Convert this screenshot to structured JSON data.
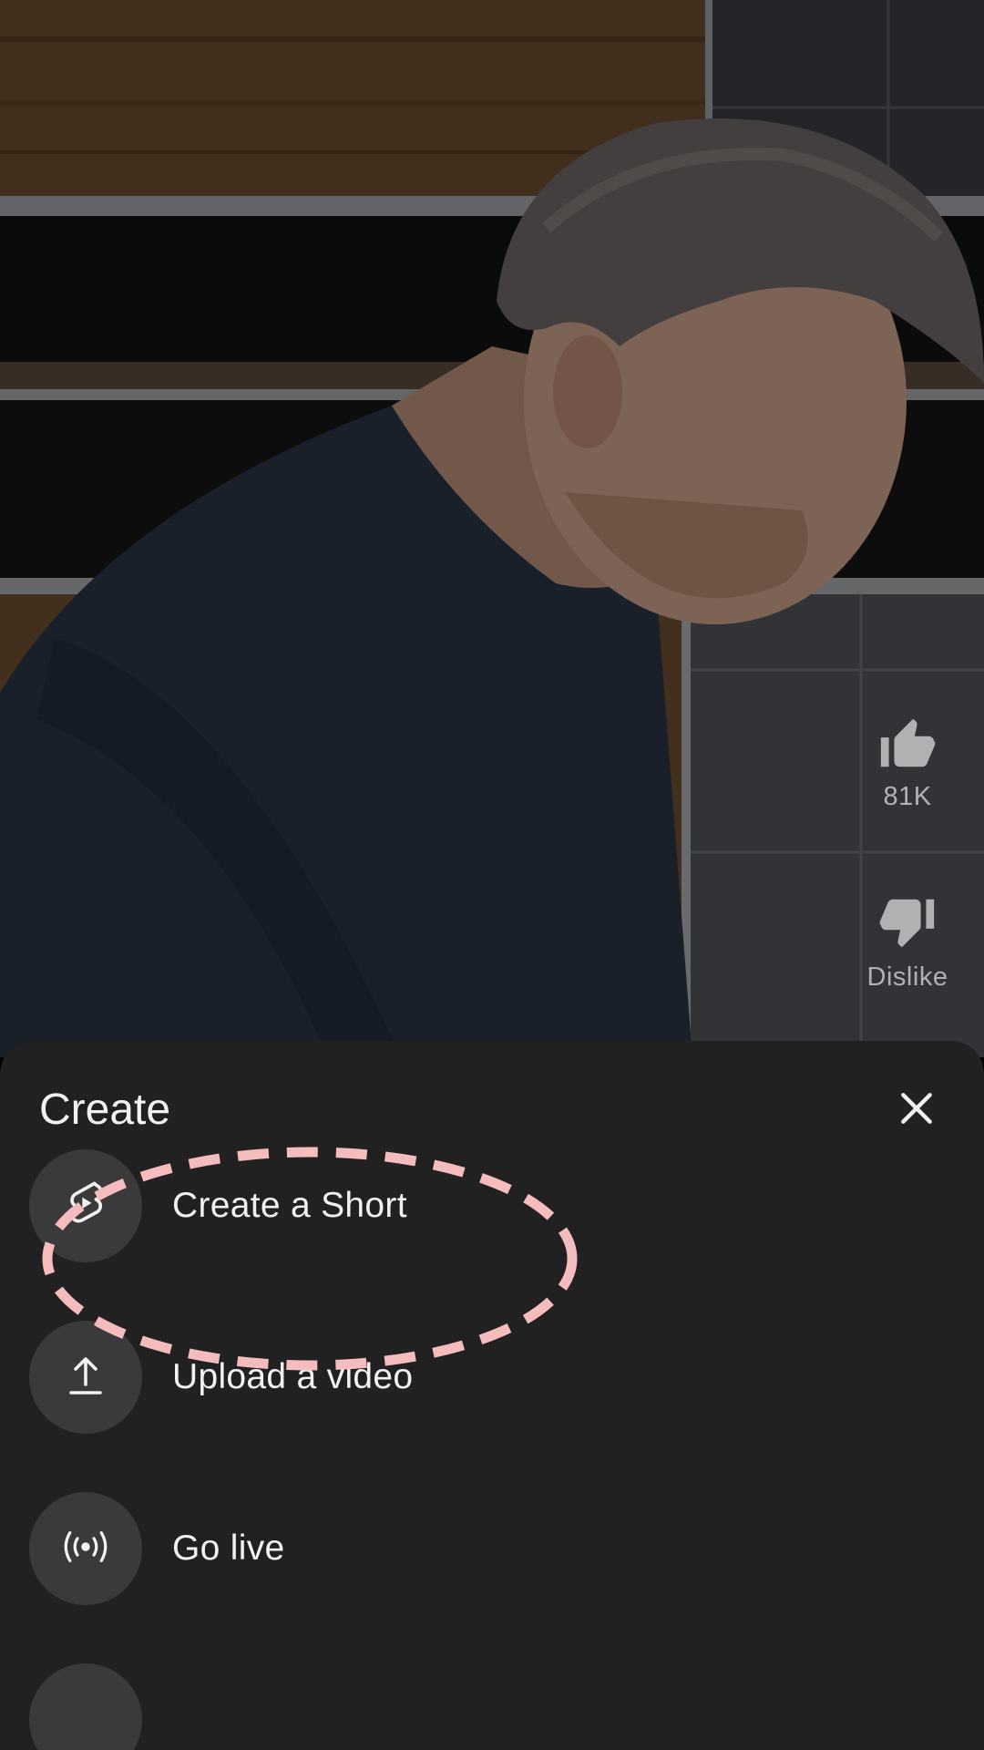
{
  "video": {
    "like_count": "81K",
    "dislike_label": "Dislike"
  },
  "create_sheet": {
    "title": "Create",
    "close_icon": "close-icon",
    "items": [
      {
        "label": "Create a Short",
        "icon": "shorts-icon"
      },
      {
        "label": "Upload a video",
        "icon": "upload-icon"
      },
      {
        "label": "Go live",
        "icon": "live-broadcast-icon"
      },
      {
        "label": "",
        "icon": "unknown-icon"
      }
    ]
  },
  "colors": {
    "sheet_bg": "#212121",
    "icon_circle_bg": "#3a3a3a",
    "text": "#f1f1f1",
    "annotation": "#f4bcbc"
  }
}
